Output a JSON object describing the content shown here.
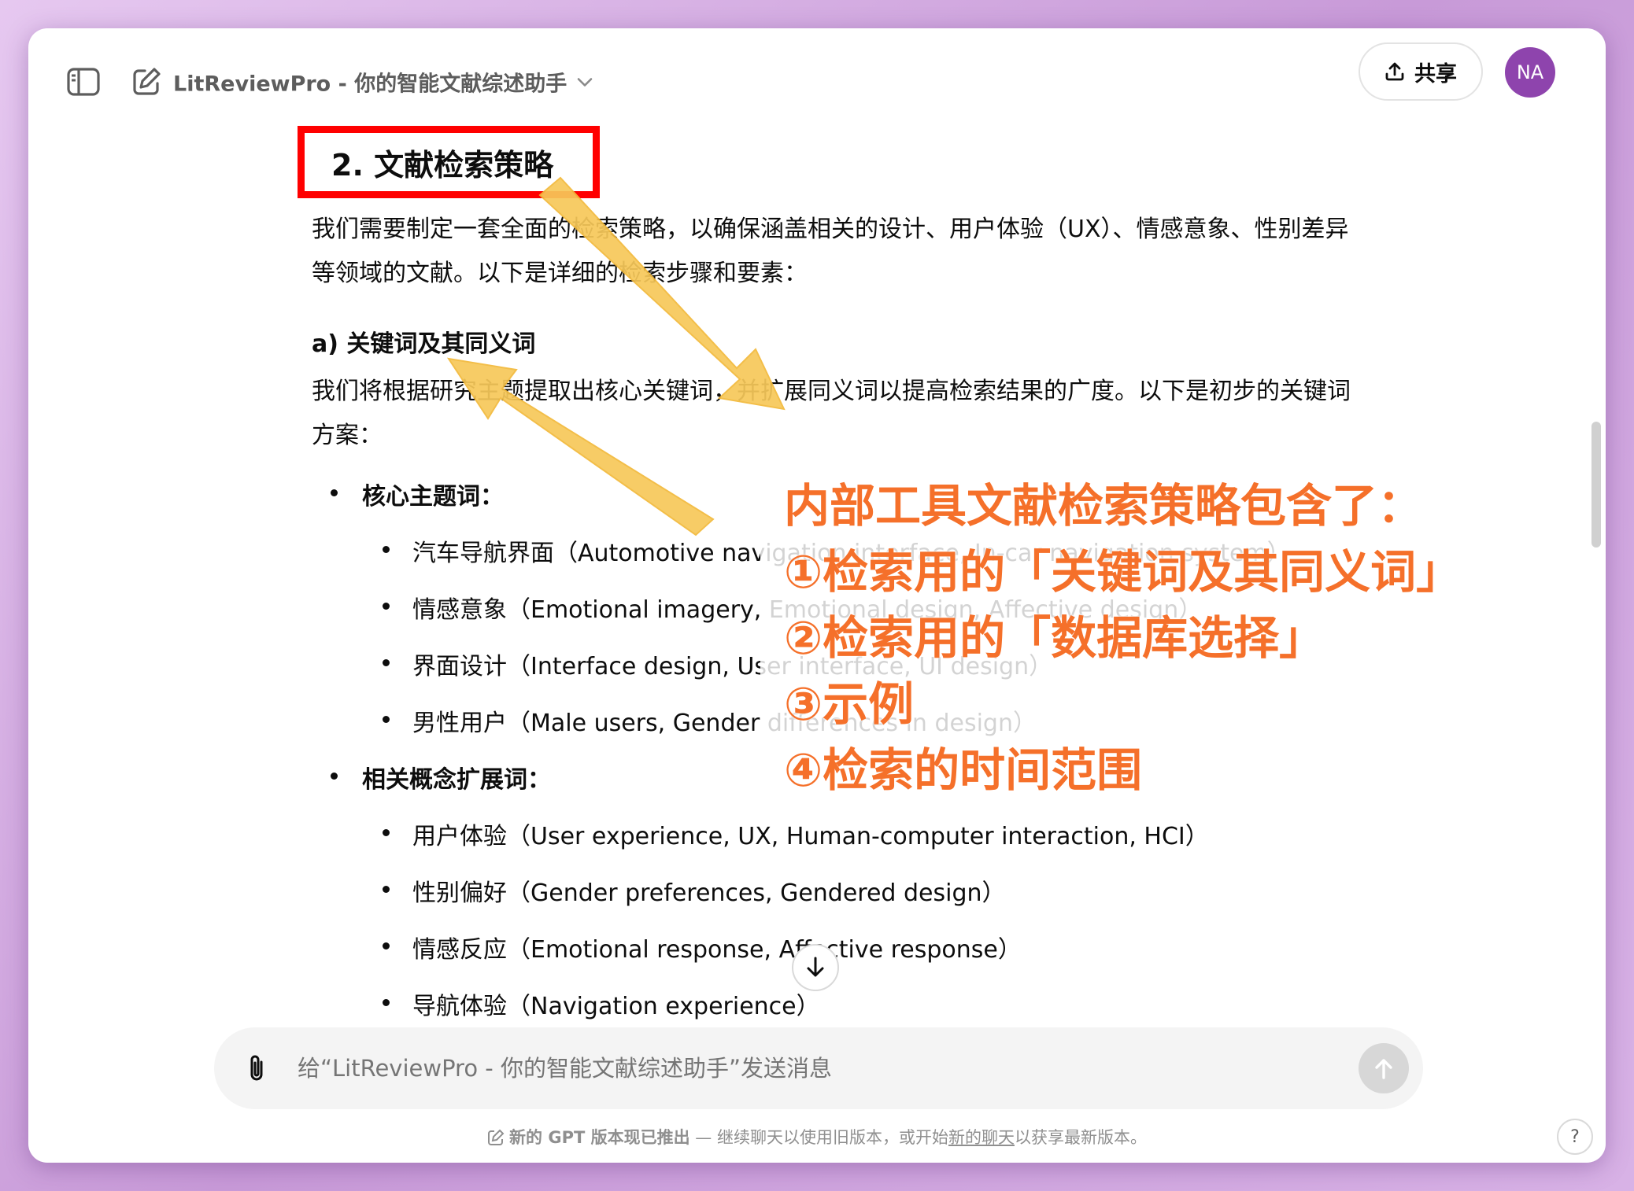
{
  "header": {
    "title": "LitReviewPro - 你的智能文献综述助手",
    "share_label": "共享",
    "avatar_initials": "NA"
  },
  "main": {
    "heading": "2. 文献检索策略",
    "intro_line1": "我们需要制定一套全面的检索策略，以确保涵盖相关的设计、用户体验（UX）、情感意象、性别差异",
    "intro_line2": "等领域的文献。以下是详细的检索步骤和要素：",
    "subheading": "a) 关键词及其同义词",
    "kw_line1": "我们将根据研究主题提取出核心关键词，并扩展同义词以提高检索结果的广度。以下是初步的关键词",
    "kw_line2": "方案：",
    "core_title": "核心主题词：",
    "core_items": [
      "汽车导航界面（Automotive navigation interface, In-car navigation system）",
      "情感意象（Emotional imagery, Emotional design, Affective design）",
      "界面设计（Interface design, User interface, UI design）",
      "男性用户（Male users, Gender differences in design）"
    ],
    "related_title": "相关概念扩展词：",
    "related_items": [
      "用户体验（User experience, UX, Human-computer interaction, HCI）",
      "性别偏好（Gender preferences, Gendered design）",
      "情感反应（Emotional response, Affective response）",
      "导航体验（Navigation experience）"
    ]
  },
  "annotation": {
    "line1": "内部工具文献检索策略包含了：",
    "line2": "①检索用的「关键词及其同义词」",
    "line3": "②检索用的「数据库选择」",
    "line4": "③示例",
    "line5": "④检索的时间范围",
    "color": "#f5702a",
    "box_color": "#ff0000",
    "arrow_color": "#f7c85a"
  },
  "composer": {
    "placeholder": "给“LitReviewPro - 你的智能文献综述助手”发送消息"
  },
  "footer": {
    "strong": "新的 GPT 版本现已推出",
    "text1": " — 继续聊天以使用旧版本，或开始",
    "link": "新的聊天",
    "text2": "以获享最新版本。",
    "help": "?"
  }
}
